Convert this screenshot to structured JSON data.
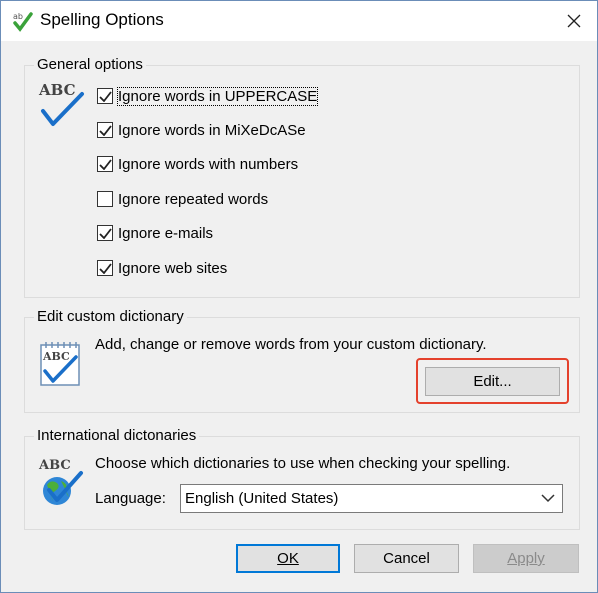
{
  "window": {
    "title": "Spelling Options"
  },
  "general": {
    "title": "General options",
    "icon_text": "ABC",
    "options": [
      {
        "label": "Ignore words in UPPERCASE",
        "checked": true
      },
      {
        "label": "Ignore words in MiXeDcASe",
        "checked": true
      },
      {
        "label": "Ignore words with numbers",
        "checked": true
      },
      {
        "label": "Ignore repeated words",
        "checked": false
      },
      {
        "label": "Ignore e-mails",
        "checked": true
      },
      {
        "label": "Ignore web sites",
        "checked": true
      }
    ]
  },
  "custom_dict": {
    "title": "Edit custom dictionary",
    "icon_text": "ABC",
    "description": "Add, change or remove words from your custom dictionary.",
    "edit_label": "Edit..."
  },
  "intl": {
    "title": "International dictonaries",
    "icon_text": "ABC",
    "description": "Choose which dictionaries to use when checking your spelling.",
    "language_label": "Language:",
    "language_value": "English (United States)"
  },
  "buttons": {
    "ok": "OK",
    "cancel": "Cancel",
    "apply": "Apply"
  },
  "colors": {
    "accent": "#0078d7",
    "highlight": "#e4412c",
    "check_blue": "#1a6fc9"
  }
}
